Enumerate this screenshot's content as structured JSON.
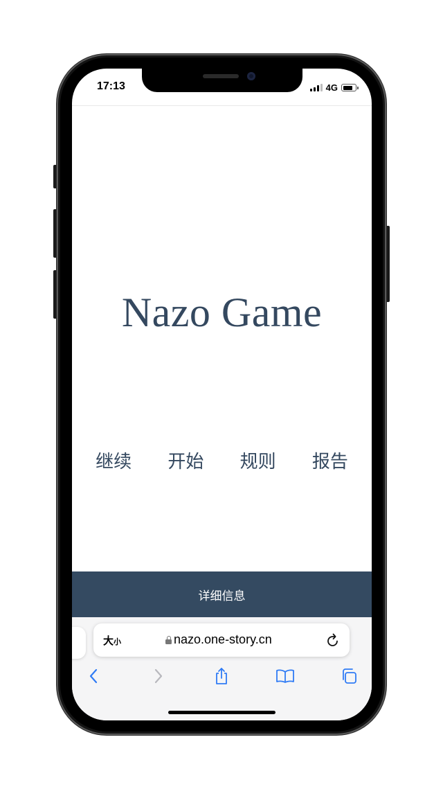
{
  "status_bar": {
    "time": "17:13",
    "network": "4G"
  },
  "page": {
    "title": "Nazo Game",
    "menu": [
      {
        "label": "继续"
      },
      {
        "label": "开始"
      },
      {
        "label": "规则"
      },
      {
        "label": "报告"
      }
    ],
    "details_button": "详细信息"
  },
  "browser": {
    "text_size_button": {
      "large": "大",
      "small": "小"
    },
    "url": "nazo.one-story.cn",
    "icons": [
      "lock-icon",
      "reload-icon",
      "back-icon",
      "forward-icon",
      "share-icon",
      "bookmarks-icon",
      "tabs-icon"
    ]
  },
  "colors": {
    "title": "#34485f",
    "details_bar": "#344a61",
    "toolbar_active": "#2f7bf5",
    "toolbar_disabled": "#b8b8bd"
  }
}
